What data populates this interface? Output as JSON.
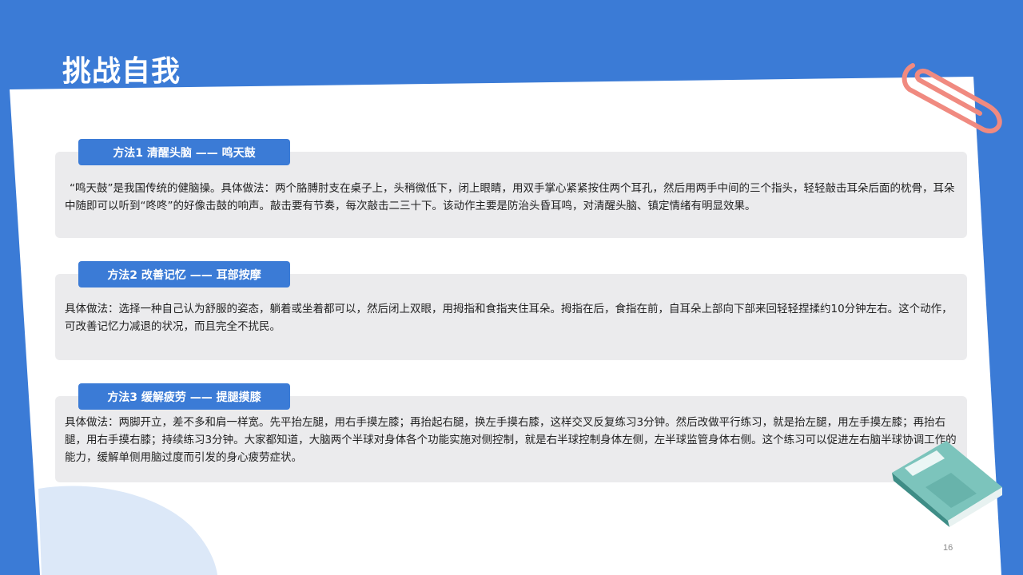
{
  "title": "挑战自我",
  "methods": [
    {
      "label": "方法1 清醒头脑 —— 鸣天鼓",
      "text": "“鸣天鼓”是我国传统的健脑操。具体做法：两个胳膊肘支在桌子上，头稍微低下，闭上眼睛，用双手掌心紧紧按住两个耳孔，然后用两手中间的三个指头，轻轻敲击耳朵后面的枕骨，耳朵中随即可以听到“咚咚”的好像击鼓的响声。敲击要有节奏，每次敲击二三十下。该动作主要是防治头昏耳鸣，对清醒头脑、镇定情绪有明显效果。"
    },
    {
      "label": "方法2 改善记忆 —— 耳部按摩",
      "text": "具体做法：选择一种自己认为舒服的姿态，躺着或坐着都可以，然后闭上双眼，用拇指和食指夹住耳朵。拇指在后，食指在前，自耳朵上部向下部来回轻轻捏揉约10分钟左右。这个动作，可改善记忆力减退的状况，而且完全不扰民。"
    },
    {
      "label": "方法3 缓解疲劳 —— 提腿摸膝",
      "text": "具体做法：两脚开立，差不多和肩一样宽。先平抬左腿，用右手摸左膝；再抬起右腿，换左手摸右膝，这样交叉反复练习3分钟。然后改做平行练习，就是抬左腿，用左手摸左膝；再抬右腿，用右手摸右膝；持续练习3分钟。大家都知道，大脑两个半球对身体各个功能实施对侧控制，就是右半球控制身体左侧，左半球监管身体右侧。这个练习可以促进左右脑半球协调工作的能力，缓解单侧用脑过度而引发的身心疲劳症状。"
    }
  ],
  "page_number": "16",
  "icons": {
    "clip": "paperclip-icon",
    "book": "book-icon"
  },
  "colors": {
    "background": "#3b7bd6",
    "tab": "#3b7bd6",
    "box": "#ebebed",
    "clip": "#f08a80",
    "book": "#6fb8b0"
  }
}
